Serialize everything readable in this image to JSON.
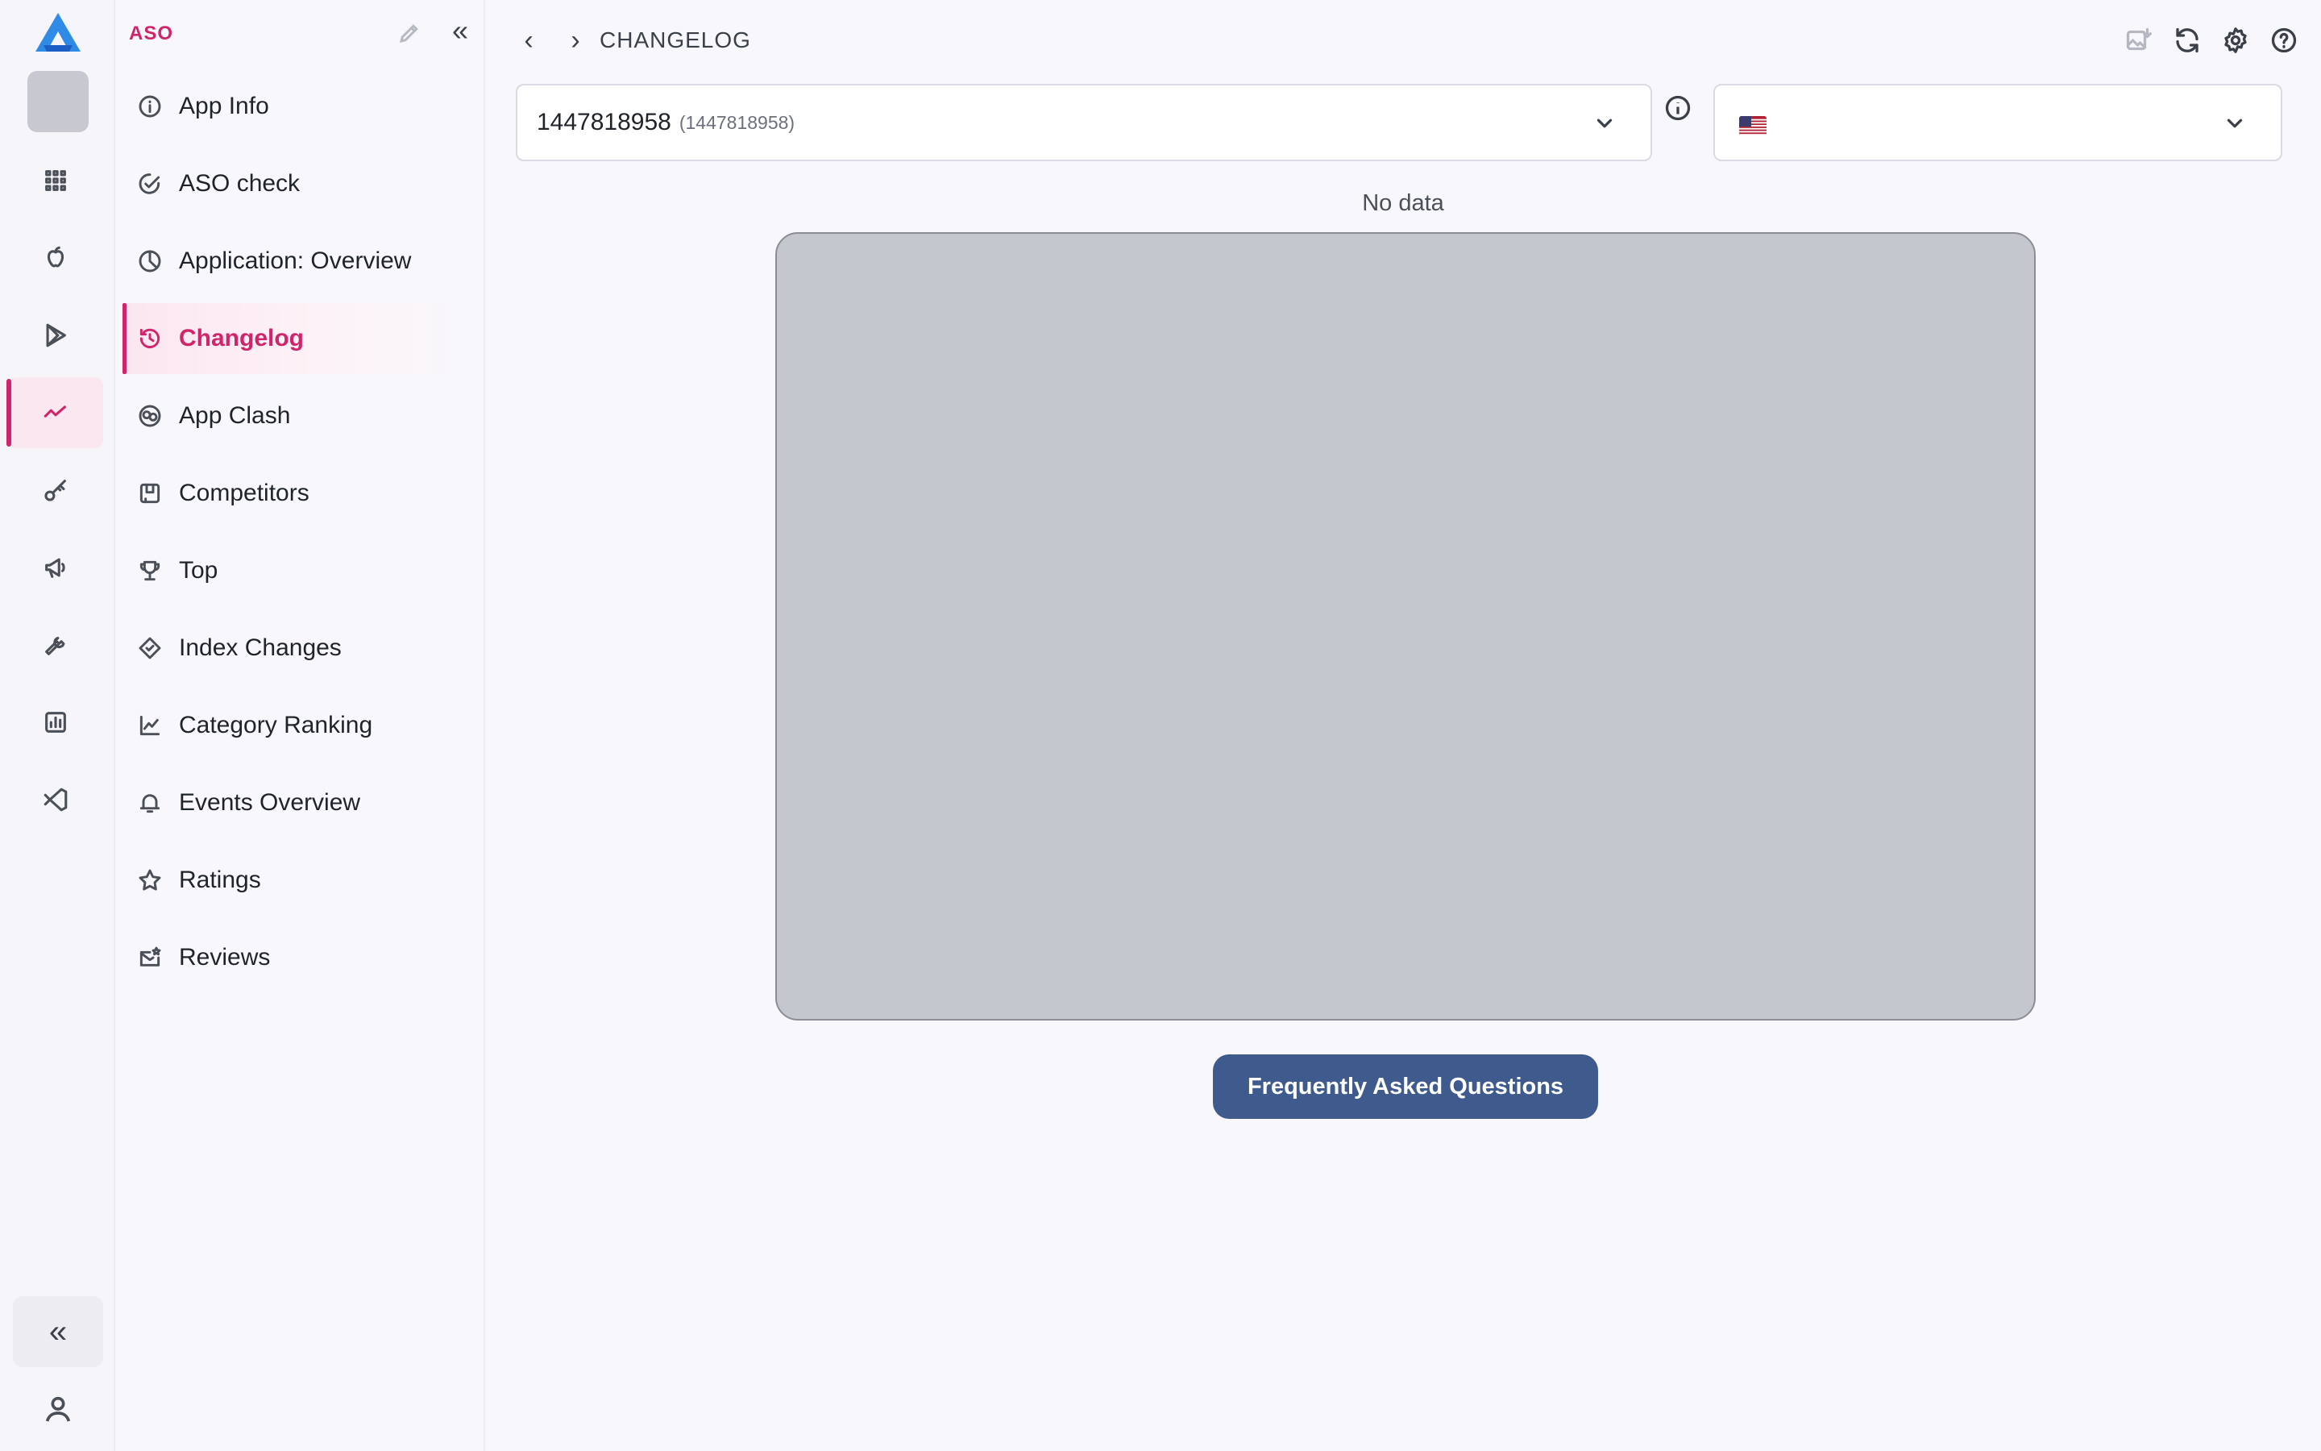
{
  "menu": {
    "title": "ASO",
    "items": [
      {
        "label": "App Info",
        "icon": "info-circle-icon"
      },
      {
        "label": "ASO check",
        "icon": "check-circle-icon"
      },
      {
        "label": "Application: Overview",
        "icon": "pie-chart-icon"
      },
      {
        "label": "Changelog",
        "icon": "history-icon",
        "active": true
      },
      {
        "label": "App Clash",
        "icon": "clash-icon"
      },
      {
        "label": "Competitors",
        "icon": "competitors-icon"
      },
      {
        "label": "Top",
        "icon": "trophy-icon"
      },
      {
        "label": "Index Changes",
        "icon": "index-changes-icon"
      },
      {
        "label": "Category Ranking",
        "icon": "line-chart-icon"
      },
      {
        "label": "Events Overview",
        "icon": "bell-icon"
      },
      {
        "label": "Ratings",
        "icon": "star-icon"
      },
      {
        "label": "Reviews",
        "icon": "reviews-icon"
      }
    ]
  },
  "header": {
    "breadcrumb": "CHANGELOG"
  },
  "app_select": {
    "value": "1447818958",
    "sub": "(1447818958)"
  },
  "country_select": {
    "flag": "us-flag-icon"
  },
  "main": {
    "no_data": "No data",
    "faq_label": "Frequently Asked Questions"
  },
  "colors": {
    "accent": "#d0246b",
    "button": "#3f5b8e",
    "placeholder": "#c5c7cf"
  }
}
